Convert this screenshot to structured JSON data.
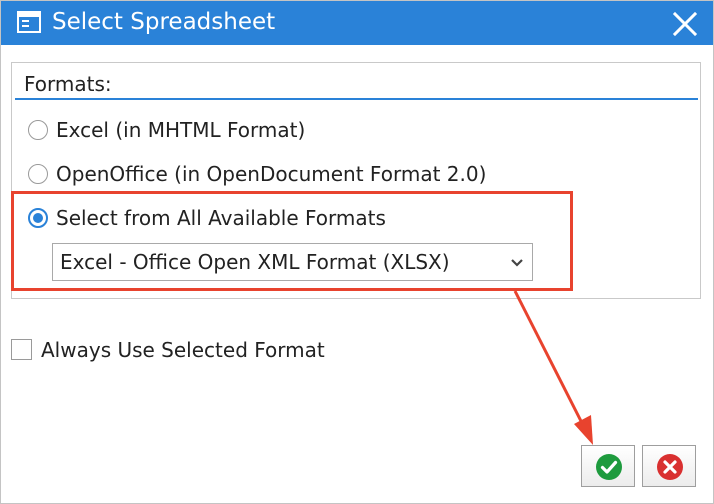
{
  "window": {
    "title": "Select Spreadsheet"
  },
  "formats": {
    "label": "Formats:",
    "options": [
      {
        "label": "Excel (in MHTML Format)",
        "selected": false
      },
      {
        "label": "OpenOffice (in OpenDocument Format 2.0)",
        "selected": false
      },
      {
        "label": "Select from All Available Formats",
        "selected": true
      }
    ],
    "dropdown": {
      "selected_value": "Excel - Office Open XML Format (XLSX)"
    }
  },
  "always_use": {
    "label": "Always Use Selected Format",
    "checked": false
  },
  "icons": {
    "title": "spreadsheet-window-icon",
    "close": "close-icon",
    "ok": "checkmark-icon",
    "cancel": "cancel-icon",
    "dropdown": "chevron-down-icon"
  },
  "colors": {
    "titlebar": "#2a82d8",
    "accent": "#2a82d8",
    "annotation": "#e8432e",
    "ok_green": "#1e9b3e",
    "cancel_red": "#d93030"
  }
}
